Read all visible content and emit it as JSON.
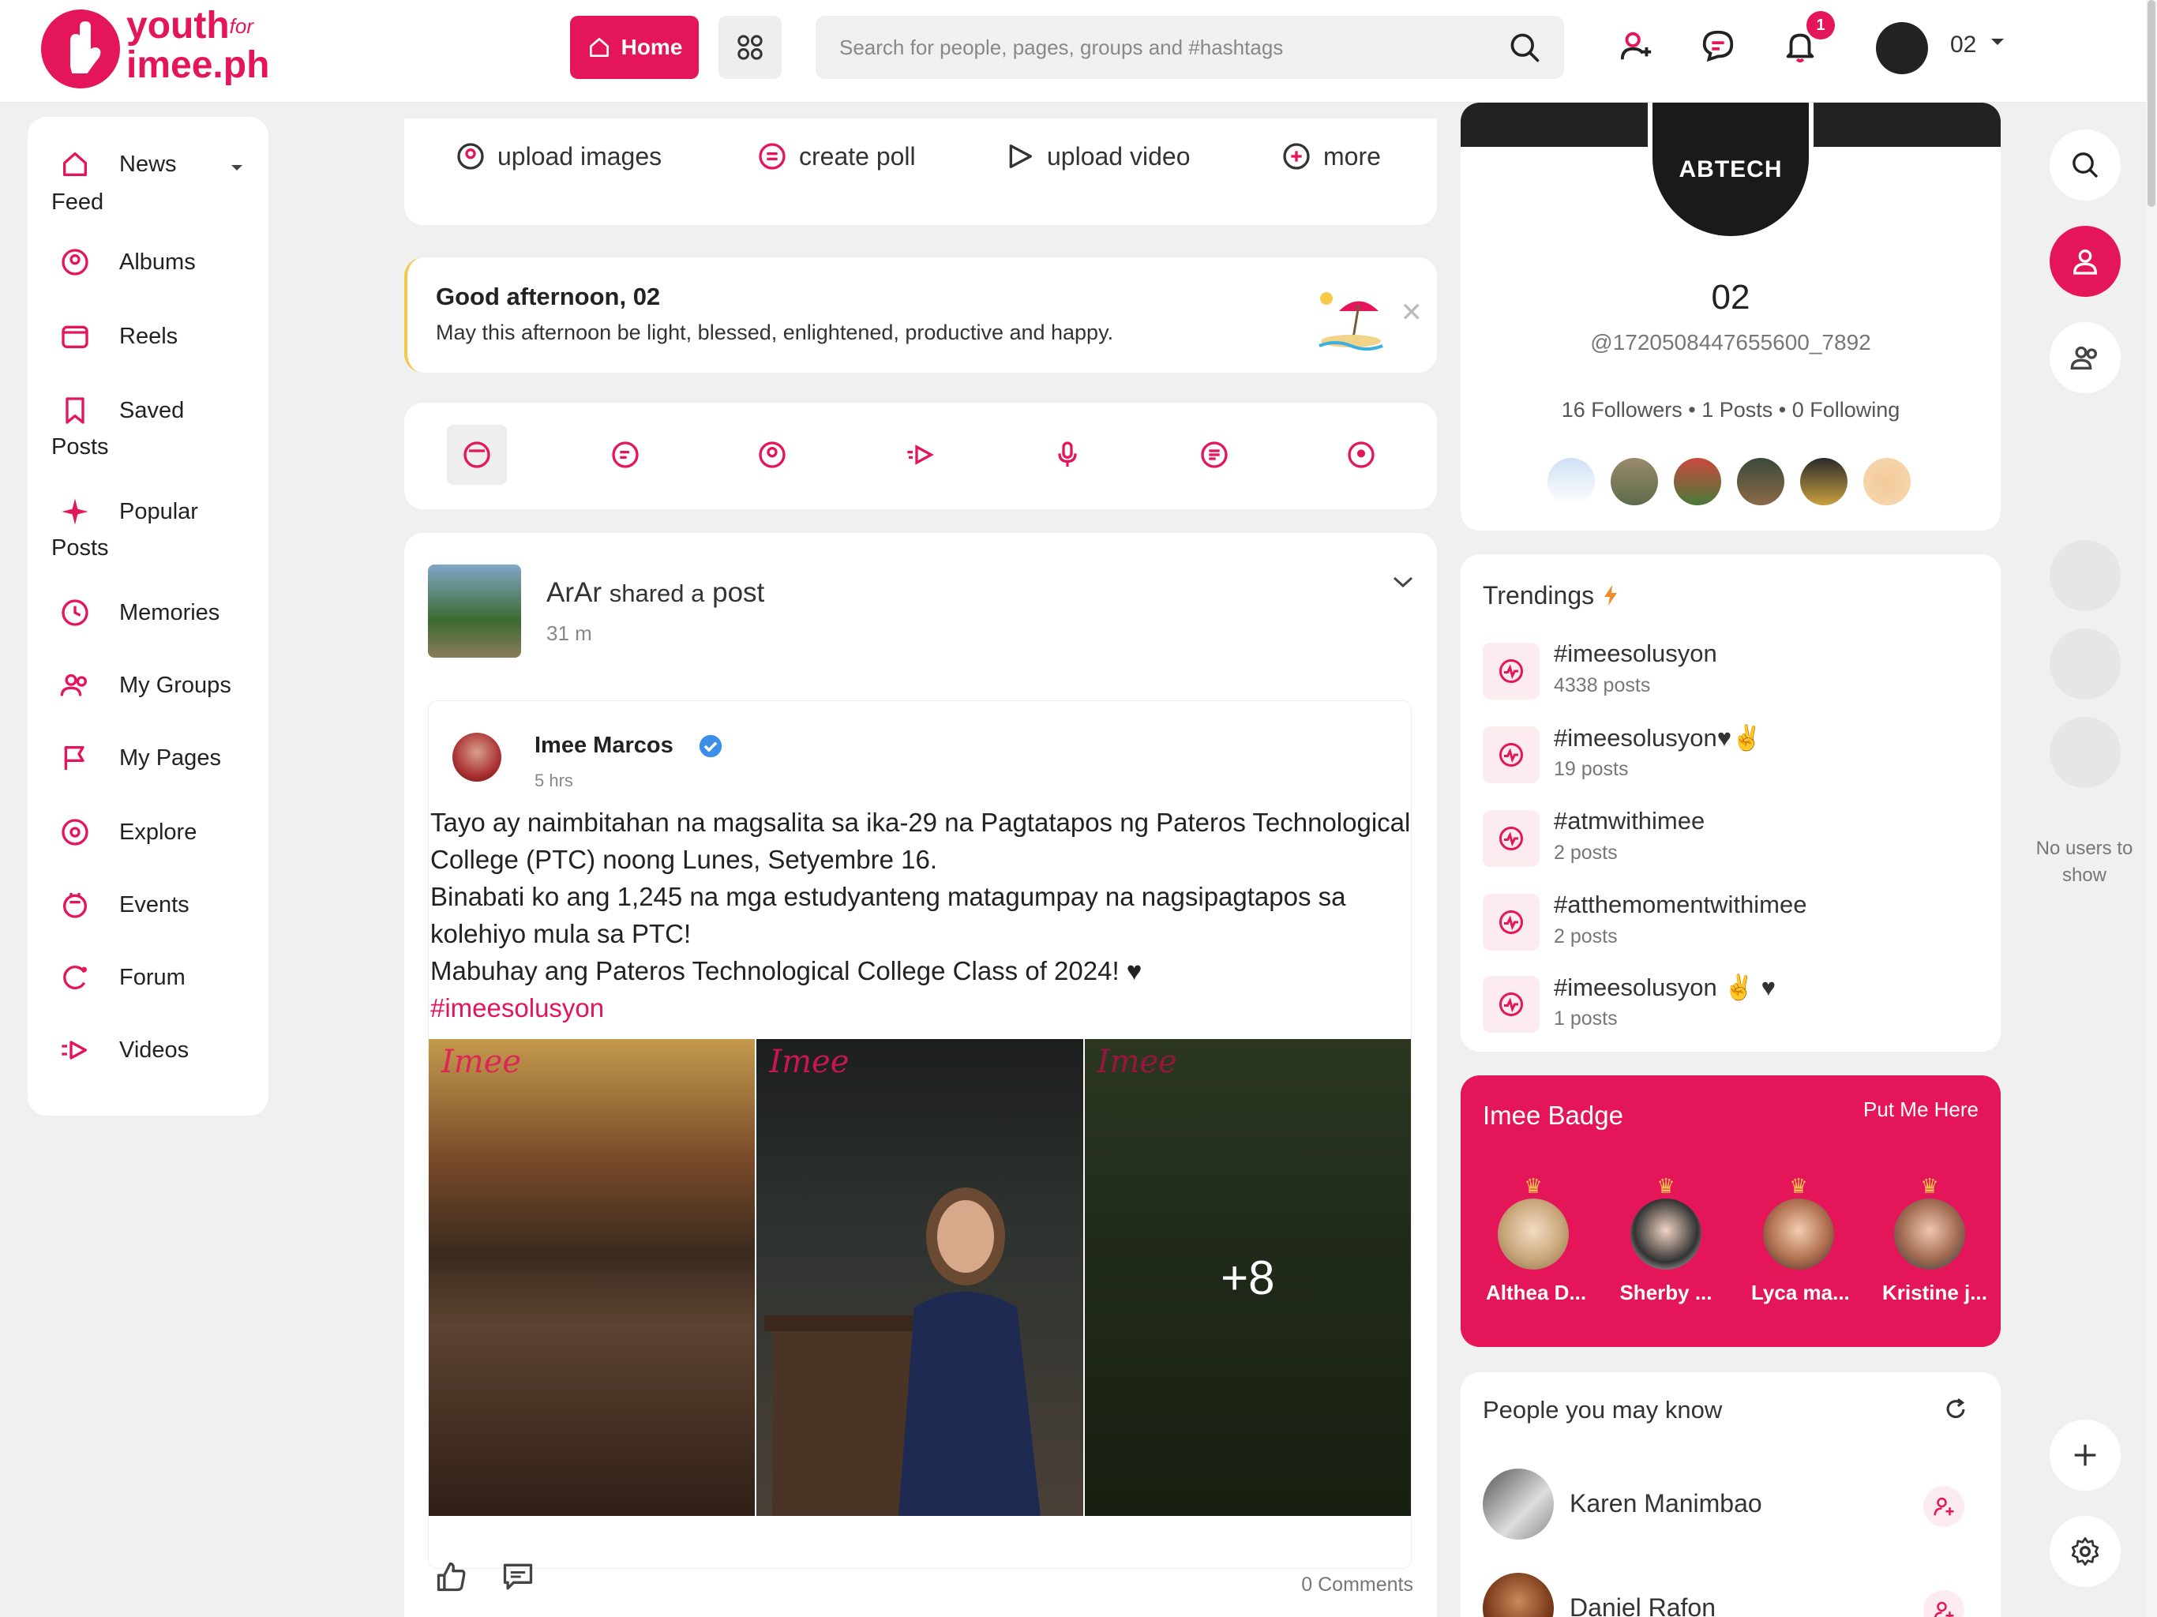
{
  "brand": {
    "name_line1": "youth",
    "name_for": "for",
    "name_line2": "imee.ph",
    "accent": "#e5155a"
  },
  "header": {
    "home_label": "Home",
    "search_placeholder": "Search for people, pages, groups and #hashtags",
    "notification_count": "1",
    "user_name": "02"
  },
  "sidebar": {
    "items": [
      {
        "label1": "News",
        "label2": "Feed",
        "icon": "home-icon"
      },
      {
        "label1": "Albums",
        "icon": "album-icon"
      },
      {
        "label1": "Reels",
        "icon": "reels-icon"
      },
      {
        "label1": "Saved",
        "label2": "Posts",
        "icon": "bookmark-icon"
      },
      {
        "label1": "Popular",
        "label2": "Posts",
        "icon": "sparkle-icon"
      },
      {
        "label1": "Memories",
        "icon": "memories-icon"
      },
      {
        "label1": "My Groups",
        "icon": "groups-icon"
      },
      {
        "label1": "My Pages",
        "icon": "flag-icon"
      },
      {
        "label1": "Explore",
        "icon": "compass-icon"
      },
      {
        "label1": "Events",
        "icon": "calendar-icon"
      },
      {
        "label1": "Forum",
        "icon": "forum-icon"
      },
      {
        "label1": "Videos",
        "icon": "video-icon"
      }
    ]
  },
  "composer": {
    "options": [
      "upload images",
      "create poll",
      "upload video",
      "more"
    ]
  },
  "greeting": {
    "title": "Good afternoon, 02",
    "subtitle": "May this afternoon be light, blessed, enlightened, productive and happy."
  },
  "post": {
    "sharer": "ArAr",
    "shared_a": "shared a",
    "post_word": "post",
    "time": "31 m",
    "author": "Imee Marcos",
    "author_time": "5 hrs",
    "text_lines": [
      "Tayo ay naimbitahan na magsalita sa ika-29 na Pagtatapos ng Pateros Technological College (PTC) noong Lunes, Setyembre 16.",
      "Binabati ko ang 1,245 na mga estudyanteng matagumpay na nagsipagtapos sa kolehiyo mula sa PTC!",
      "Mabuhay ang Pateros Technological College Class of 2024! ♥"
    ],
    "hashtag": "#imeesolusyon",
    "more_photos": "+8",
    "comments": "0 Comments"
  },
  "profile": {
    "name": "02",
    "handle": "@1720508447655600_7892",
    "stats": "16 Followers • 1 Posts • 0 Following",
    "avatar_text": "ABTECH"
  },
  "trendings": {
    "title": "Trendings",
    "items": [
      {
        "tag": "#imeesolusyon",
        "count": "4338 posts"
      },
      {
        "tag": "#imeesolusyon♥✌",
        "count": "19 posts"
      },
      {
        "tag": "#atmwithimee",
        "count": "2 posts"
      },
      {
        "tag": "#atthemomentwithimee",
        "count": "2 posts"
      },
      {
        "tag": "#imeesolusyon ✌ ♥",
        "count": "1 posts"
      }
    ]
  },
  "badge": {
    "title": "Imee Badge",
    "link": "Put Me Here",
    "users": [
      "Althea D...",
      "Sherby ...",
      "Lyca ma...",
      "Kristine j..."
    ]
  },
  "people": {
    "title": "People you may know",
    "items": [
      "Karen Manimbao",
      "Daniel Rafon"
    ]
  },
  "rail": {
    "no_users": "No users to show"
  }
}
